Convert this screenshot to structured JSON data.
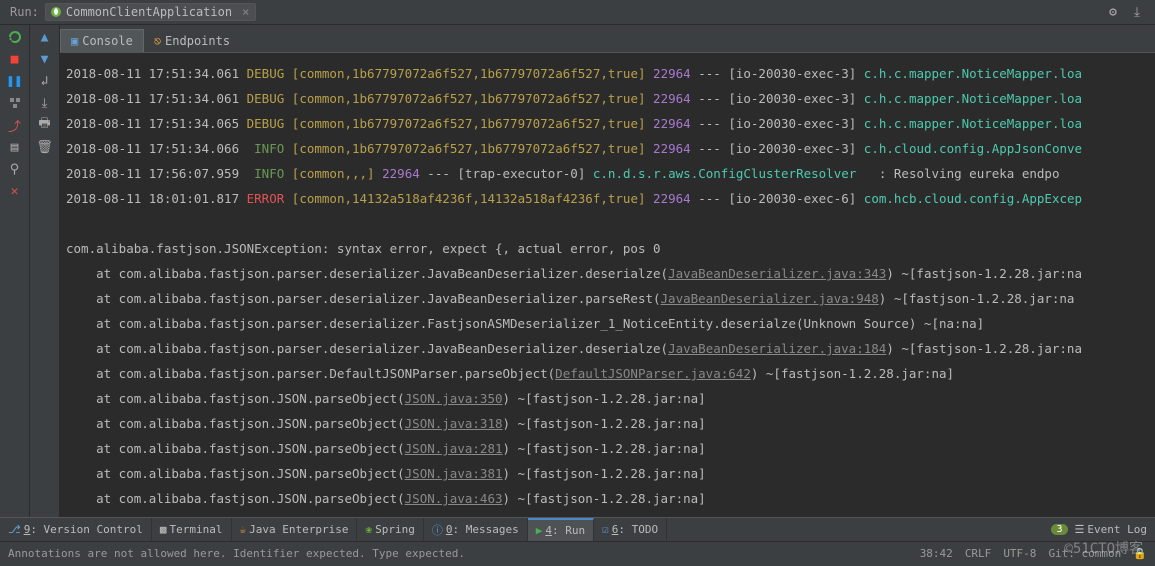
{
  "header": {
    "run_label": "Run:",
    "config": "CommonClientApplication"
  },
  "tabs": {
    "console": "Console",
    "endpoints": "Endpoints"
  },
  "log_lines": [
    {
      "ts": "2018-08-11 17:51:34.061",
      "level": "DEBUG",
      "ctx": "[common,1b67797072a6f527,1b67797072a6f527,true]",
      "pid": "22964",
      "thread": "[io-20030-exec-3]",
      "cls": "c.h.c.mapper.NoticeMapper.loa"
    },
    {
      "ts": "2018-08-11 17:51:34.061",
      "level": "DEBUG",
      "ctx": "[common,1b67797072a6f527,1b67797072a6f527,true]",
      "pid": "22964",
      "thread": "[io-20030-exec-3]",
      "cls": "c.h.c.mapper.NoticeMapper.loa"
    },
    {
      "ts": "2018-08-11 17:51:34.065",
      "level": "DEBUG",
      "ctx": "[common,1b67797072a6f527,1b67797072a6f527,true]",
      "pid": "22964",
      "thread": "[io-20030-exec-3]",
      "cls": "c.h.c.mapper.NoticeMapper.loa"
    },
    {
      "ts": "2018-08-11 17:51:34.066",
      "level": "INFO",
      "ctx": "[common,1b67797072a6f527,1b67797072a6f527,true]",
      "pid": "22964",
      "thread": "[io-20030-exec-3]",
      "cls": "c.h.cloud.config.AppJsonConve"
    },
    {
      "ts": "2018-08-11 17:56:07.959",
      "level": "INFO",
      "ctx": "[common,,,]",
      "pid": "22964",
      "thread": "[trap-executor-0]",
      "cls": "c.n.d.s.r.aws.ConfigClusterResolver",
      "msg": "   : Resolving eureka endpo"
    },
    {
      "ts": "2018-08-11 18:01:01.817",
      "level": "ERROR",
      "ctx": "[common,14132a518af4236f,14132a518af4236f,true]",
      "pid": "22964",
      "thread": "[io-20030-exec-6]",
      "cls": "com.hcb.cloud.config.AppExcep"
    }
  ],
  "exception": "com.alibaba.fastjson.JSONException: syntax error, expect {, actual error, pos 0",
  "stack": [
    {
      "pre": "    at com.alibaba.fastjson.parser.deserializer.JavaBeanDeserializer.deserialze(",
      "link": "JavaBeanDeserializer.java:343",
      "post": ") ~[fastjson-1.2.28.jar:na"
    },
    {
      "pre": "    at com.alibaba.fastjson.parser.deserializer.JavaBeanDeserializer.parseRest(",
      "link": "JavaBeanDeserializer.java:948",
      "post": ") ~[fastjson-1.2.28.jar:na"
    },
    {
      "pre": "    at com.alibaba.fastjson.parser.deserializer.FastjsonASMDeserializer_1_NoticeEntity.deserialze(Unknown Source) ~[na:na]",
      "link": "",
      "post": ""
    },
    {
      "pre": "    at com.alibaba.fastjson.parser.deserializer.JavaBeanDeserializer.deserialze(",
      "link": "JavaBeanDeserializer.java:184",
      "post": ") ~[fastjson-1.2.28.jar:na"
    },
    {
      "pre": "    at com.alibaba.fastjson.parser.DefaultJSONParser.parseObject(",
      "link": "DefaultJSONParser.java:642",
      "post": ") ~[fastjson-1.2.28.jar:na]"
    },
    {
      "pre": "    at com.alibaba.fastjson.JSON.parseObject(",
      "link": "JSON.java:350",
      "post": ") ~[fastjson-1.2.28.jar:na]"
    },
    {
      "pre": "    at com.alibaba.fastjson.JSON.parseObject(",
      "link": "JSON.java:318",
      "post": ") ~[fastjson-1.2.28.jar:na]"
    },
    {
      "pre": "    at com.alibaba.fastjson.JSON.parseObject(",
      "link": "JSON.java:281",
      "post": ") ~[fastjson-1.2.28.jar:na]"
    },
    {
      "pre": "    at com.alibaba.fastjson.JSON.parseObject(",
      "link": "JSON.java:381",
      "post": ") ~[fastjson-1.2.28.jar:na]"
    },
    {
      "pre": "    at com.alibaba.fastjson.JSON.parseObject(",
      "link": "JSON.java:463",
      "post": ") ~[fastjson-1.2.28.jar:na]"
    }
  ],
  "bottom": {
    "version_control": {
      "num": "9",
      "label": ": Version Control"
    },
    "terminal": "Terminal",
    "java_ee": "Java Enterprise",
    "spring": "Spring",
    "messages": {
      "num": "0",
      "label": ": Messages"
    },
    "run": {
      "num": "4",
      "label": ": Run"
    },
    "todo": {
      "num": "6",
      "label": ": TODO"
    },
    "event_log": "Event Log",
    "event_count": "3"
  },
  "status": {
    "left": "Annotations are not allowed here. Identifier expected. Type expected.",
    "pos": "38:42",
    "eol": "CRLF",
    "arrow": "⮐",
    "enc": "UTF-8",
    "arrow2": "⮐",
    "branch": "Git: common",
    "arrow3": "⮐"
  },
  "watermark": "©51CTO博客"
}
